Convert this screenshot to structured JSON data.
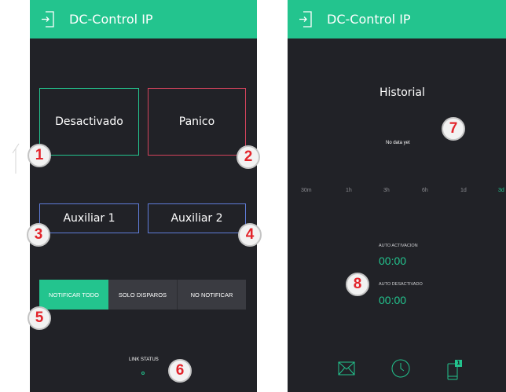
{
  "left": {
    "app_title": "DC-Control IP",
    "buttons": {
      "desactivado": "Desactivado",
      "panico": "Panico",
      "auxiliar1": "Auxiliar 1",
      "auxiliar2": "Auxiliar 2"
    },
    "segmented": [
      "NOTIFICAR TODO",
      "SOLO DISPAROS",
      "NO NOTIFICAR"
    ],
    "link_status": "LINK STATUS"
  },
  "right": {
    "app_title": "DC-Control IP",
    "historial_title": "Historial",
    "no_data": "No data yet",
    "timeframes": [
      "30m",
      "1h",
      "3h",
      "6h",
      "1d",
      "3d"
    ],
    "auto_activacion_label": "AUTO ACTIVACION",
    "auto_activacion_value": "00:00",
    "auto_desactivado_label": "AUTO DESACTIVADO",
    "auto_desactivado_value": "00:00",
    "nav_badge": "1"
  },
  "badges": [
    "1",
    "2",
    "3",
    "4",
    "5",
    "6",
    "7",
    "8"
  ],
  "colors": {
    "accent": "#23c48e",
    "background": "#212227",
    "panic": "#d3435c",
    "auxiliar": "#5f7cd8",
    "badge_number": "#e3242b"
  },
  "icons": [
    "exit-icon",
    "mail-icon",
    "clock-icon",
    "phone-notification-icon"
  ]
}
